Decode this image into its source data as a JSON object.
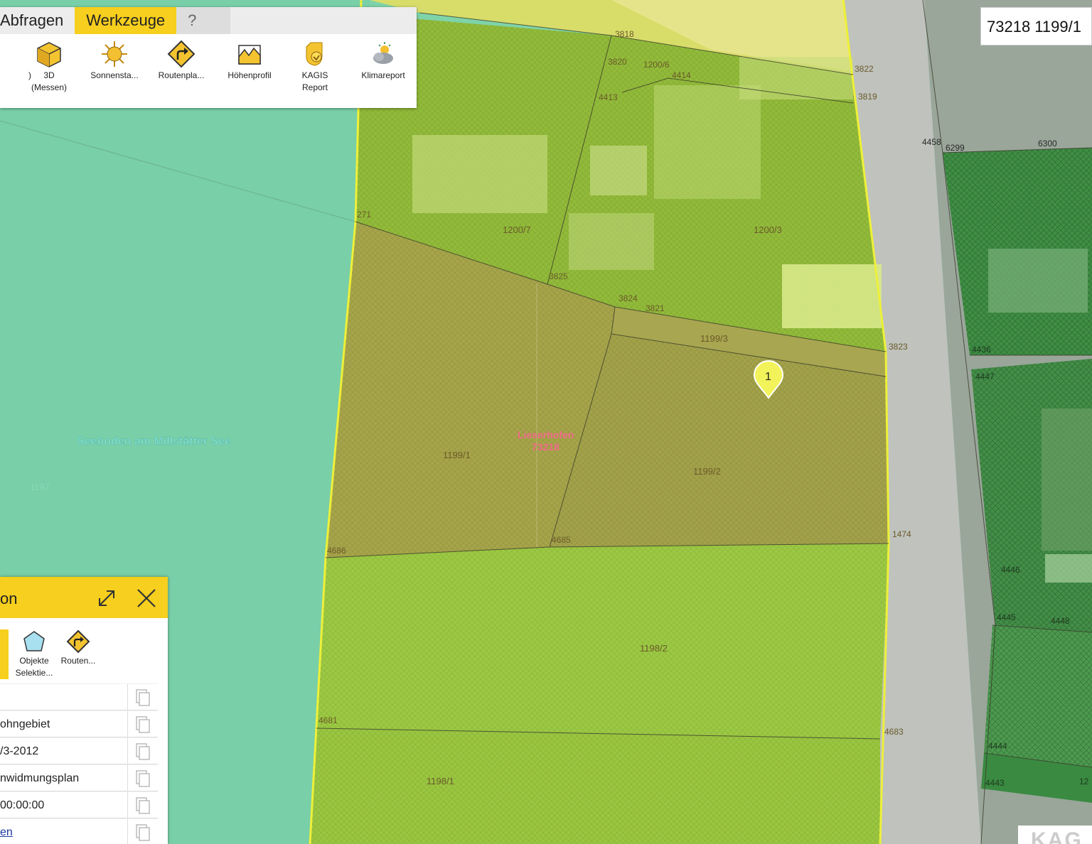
{
  "toolbar": {
    "tabs": [
      {
        "label": "Abfragen"
      },
      {
        "label": "Werkzeuge"
      },
      {
        "label": "?"
      }
    ],
    "tools": [
      {
        "label_1": ")",
        "label_2": ""
      },
      {
        "label_1": "3D",
        "label_2": "(Messen)"
      },
      {
        "label_1": "Sonnensta...",
        "label_2": ""
      },
      {
        "label_1": "Routenpla...",
        "label_2": ""
      },
      {
        "label_1": "Höhenprofil",
        "label_2": ""
      },
      {
        "label_1": "KAGIS",
        "label_2": "Report"
      },
      {
        "label_1": "Klimareport",
        "label_2": ""
      }
    ]
  },
  "parcel_id_label": "73218 1199/1",
  "map": {
    "place_label": "Seeboden am Millstätter See",
    "town_label_1": "Lieserhofen",
    "town_label_2": "73218",
    "marker_label": "1",
    "parcels": {
      "p1197": "1197",
      "p1199_1": "1199/1",
      "p1199_2": "1199/2",
      "p1199_3": "1199/3",
      "p1198_2": "1198/2",
      "p1198_1": "1198/1",
      "p1200_7": "1200/7",
      "p1200_3": "1200/3",
      "p1200_6": "1200/6",
      "p271": "271",
      "p3825": "3825",
      "p3824": "3824",
      "p3821": "3821",
      "p3823": "3823",
      "p3822": "3822",
      "p3819": "3819",
      "p3818": "3818",
      "p3820": "3820",
      "p4414": "4414",
      "p4413": "4413",
      "p4686": "4686",
      "p4685": "4685",
      "p1474": "1474",
      "p4681": "4681",
      "p4683": "4683",
      "p4458": "4458",
      "p6299": "6299",
      "p6300": "6300",
      "p4436": "4436",
      "p4447": "4447",
      "p4446": "4446",
      "p4445": "4445",
      "p4448": "4448",
      "p4444": "4444",
      "p4443": "4443",
      "p12": "12"
    }
  },
  "panel": {
    "title": "on",
    "tools": [
      {
        "label_1": "Objekte",
        "label_2": "Selektie..."
      },
      {
        "label_1": "Routen...",
        "label_2": ""
      }
    ],
    "rows": [
      {
        "value": ""
      },
      {
        "value": "ohngebiet"
      },
      {
        "value": "/3-2012"
      },
      {
        "value": "nwidmungsplan"
      },
      {
        "value": "00:00:00"
      },
      {
        "value": "en"
      }
    ]
  },
  "watermark": "KAG"
}
